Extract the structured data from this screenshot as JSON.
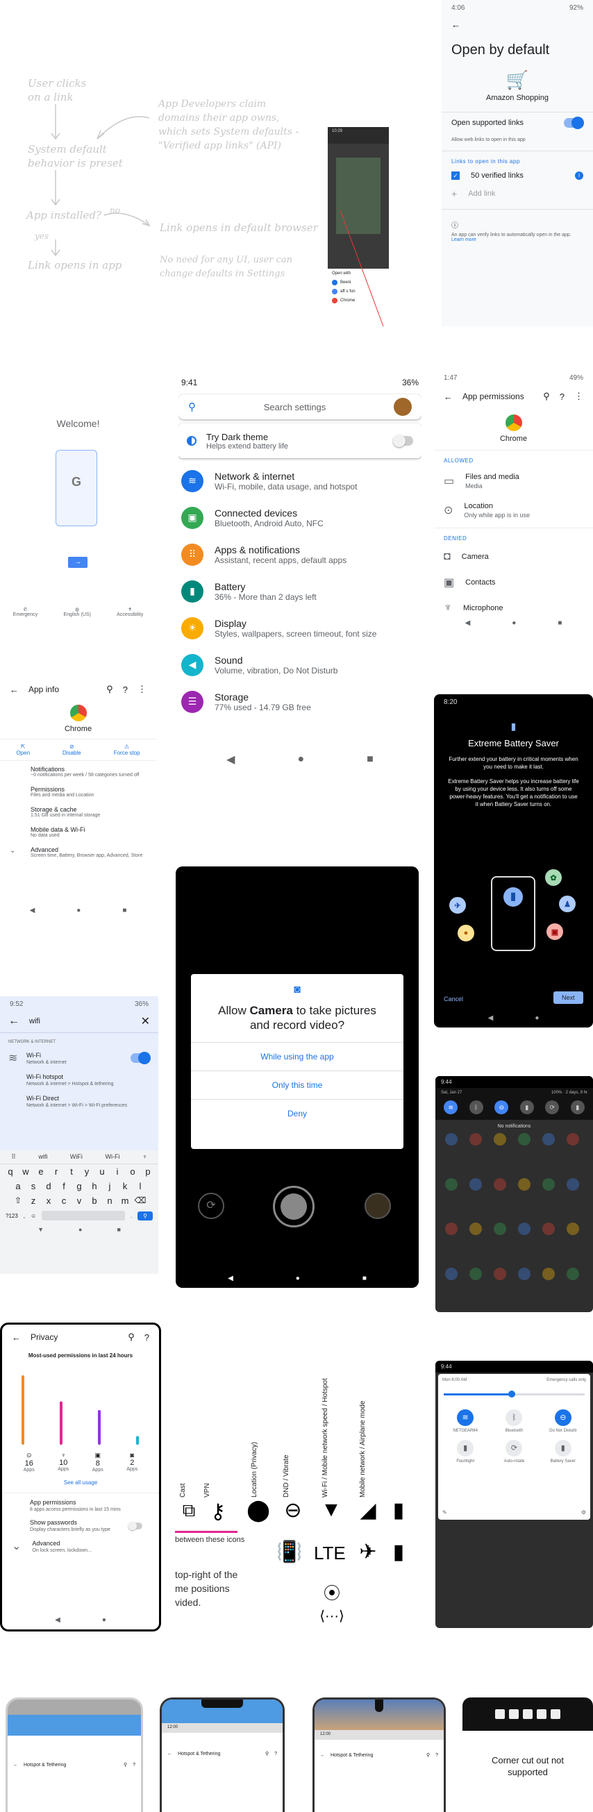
{
  "flow": {
    "n1": "User clicks\non a link",
    "n2": "System default\nbehavior is preset",
    "n3": "App installed?",
    "yes": "yes",
    "no": "no",
    "n4": "Link opens in app",
    "n5": "Link opens in default browser",
    "n6": "App Developers claim\ndomains their app owns,\nwhich sets System defaults -\n\"Verified app links\" (API)",
    "n7": "No need for any UI, user can\nchange defaults in Settings"
  },
  "chooser": {
    "time": "10:29",
    "title": "Open with",
    "apps": [
      "Beeni",
      "aff·s fun",
      "Chrome"
    ]
  },
  "obd": {
    "time": "4:06",
    "battery": "92%",
    "title": "Open by default",
    "app": "Amazon Shopping",
    "toggle_label": "Open supported links",
    "allow": "Allow web links to open in this app",
    "section": "Links to open in this app",
    "verified": "50 verified links",
    "add": "Add link",
    "info": "An app can verify links to automatically open in the app.",
    "learn": "Learn more"
  },
  "welcome": {
    "title": "Welcome!",
    "bottom": [
      "Emergency",
      "English (US)",
      "Accessibility"
    ]
  },
  "settings": {
    "time": "9:41",
    "battery": "36%",
    "search": "Search settings",
    "dark_title": "Try Dark theme",
    "dark_sub": "Helps extend battery life",
    "items": [
      {
        "icon": "wifi-icon",
        "color": "#1a73e8",
        "glyph": "≋",
        "title": "Network & internet",
        "sub": "Wi-Fi, mobile, data usage, and hotspot"
      },
      {
        "icon": "devices-icon",
        "color": "#34a853",
        "glyph": "▣",
        "title": "Connected devices",
        "sub": "Bluetooth, Android Auto, NFC"
      },
      {
        "icon": "apps-icon",
        "color": "#f28b22",
        "glyph": "⠿",
        "title": "Apps & notifications",
        "sub": "Assistant, recent apps, default apps"
      },
      {
        "icon": "battery-icon",
        "color": "#00897b",
        "glyph": "▮",
        "title": "Battery",
        "sub": "36% - More than 2 days left"
      },
      {
        "icon": "display-icon",
        "color": "#f9ab00",
        "glyph": "☀",
        "title": "Display",
        "sub": "Styles, wallpapers, screen timeout, font size"
      },
      {
        "icon": "sound-icon",
        "color": "#12b5cb",
        "glyph": "◀",
        "title": "Sound",
        "sub": "Volume, vibration, Do Not Disturb"
      },
      {
        "icon": "storage-icon",
        "color": "#9c27b0",
        "glyph": "☰",
        "title": "Storage",
        "sub": "77% used - 14.79 GB free"
      }
    ]
  },
  "perm": {
    "time": "1:47",
    "battery": "49%",
    "title": "App permissions",
    "app": "Chrome",
    "allowed": "ALLOWED",
    "denied": "DENIED",
    "allowed_items": [
      {
        "t": "Files and media",
        "s": "Media"
      },
      {
        "t": "Location",
        "s": "Only while app is in use"
      }
    ],
    "denied_items": [
      "Camera",
      "Contacts",
      "Microphone"
    ]
  },
  "appinfo": {
    "title": "App info",
    "app": "Chrome",
    "actions": [
      "Open",
      "Disable",
      "Force stop"
    ],
    "rows": [
      {
        "t": "Notifications",
        "s": "~0 notifications per week / 58 categories turned off"
      },
      {
        "t": "Permissions",
        "s": "Files and media and Location"
      },
      {
        "t": "Storage & cache",
        "s": "1.51 GB used in internal storage"
      },
      {
        "t": "Mobile data & Wi-Fi",
        "s": "No data used"
      },
      {
        "t": "Advanced",
        "s": "Screen time, Battery, Browser app, Advanced, Store"
      }
    ]
  },
  "ebs": {
    "time": "8:20",
    "title": "Extreme Battery Saver",
    "p1": "Further extend your battery in critical moments when you need to make it last.",
    "p2": "Extreme Battery Saver helps you increase battery life by using your device less. It also turns off some power-heavy features. You'll get a notification to use it when Battery Saver turns on.",
    "cancel": "Cancel",
    "next": "Next"
  },
  "camera": {
    "pre": "Allow ",
    "app": "Camera",
    "post": " to take pictures and record video?",
    "options": [
      "While using the app",
      "Only this time",
      "Deny"
    ]
  },
  "search": {
    "time": "9:52",
    "battery": "36%",
    "query": "wifi",
    "section": "NETWORK & INTERNET",
    "results": [
      {
        "t": "Wi-Fi",
        "s": "Network & internet"
      },
      {
        "t": "Wi-Fi hotspot",
        "s": "Network & internet > Hotspot & tethering"
      },
      {
        "t": "Wi-Fi Direct",
        "s": "Network & internet > Wi-Fi > Wi-Fi preferences"
      }
    ],
    "suggest": [
      "wifi",
      "WiFi",
      "Wi-Fi"
    ],
    "rows": [
      "qwertyuiop",
      "asdfghjkl",
      "zxcvbnm"
    ],
    "num": "?123"
  },
  "notif": {
    "time": "9:44",
    "date": "Sat, Jan 27",
    "batt": "100% · 2 days, 9 hr",
    "empty": "No notifications"
  },
  "privacy": {
    "title": "Privacy",
    "sub": "Most-used permissions in last 24 hours",
    "bars": [
      {
        "v": 16,
        "c": "#f28b22"
      },
      {
        "v": 10,
        "c": "#e52592"
      },
      {
        "v": 8,
        "c": "#9334e6"
      },
      {
        "v": 2,
        "c": "#12b5cb"
      }
    ],
    "unit": "Apps",
    "see": "See all usage",
    "rows": [
      {
        "t": "App permissions",
        "s": "8 apps access permissions in last 15 mins"
      },
      {
        "t": "Show passwords",
        "s": "Display characters briefly as you type"
      },
      {
        "t": "Advanced",
        "s": "On lock screen, lockdown..."
      }
    ]
  },
  "icons": {
    "labels": [
      "Cast",
      "VPN",
      "Location (Privacy)",
      "DND / Vibrate",
      "Wi-Fi / Mobile network speed / Hotspot",
      "Mobile network / Airplane mode"
    ],
    "between": "between these icons",
    "caption": "top-right of the\nme positions\nvided.",
    "lte": "LTE"
  },
  "qs": {
    "time": "9:44",
    "date": "Mon 6:00 AM",
    "emergency": "Emergency calls only",
    "tiles": [
      "NETGEAR64",
      "Bluetooth",
      "Do Not Disturb",
      "Flashlight",
      "Auto-rotate",
      "Battery Saver"
    ]
  },
  "cutouts": {
    "label": "Hotspot & Tethering",
    "time": "12:00",
    "none": "Corner cut out not supported"
  }
}
